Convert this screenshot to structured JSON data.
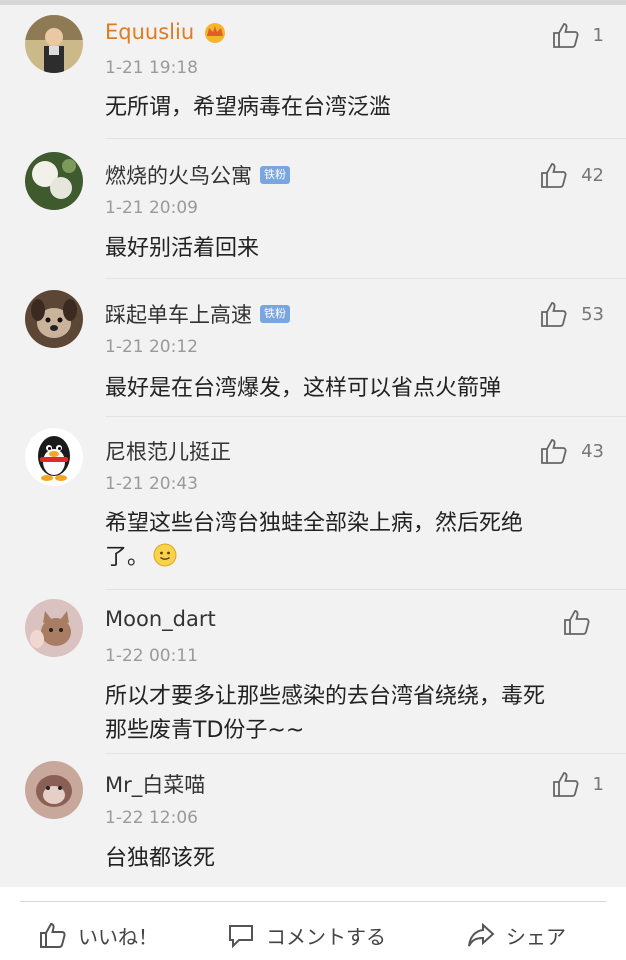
{
  "comments": [
    {
      "avatar_icon": "avatar-man-icon",
      "username": "Equusliu",
      "username_badge": "vip-crown-icon",
      "time": "1-21 19:18",
      "text": "无所谓，希望病毒在台湾泛滥",
      "likes": "1"
    },
    {
      "avatar_icon": "avatar-flower-icon",
      "username": "燃烧的火鸟公寓",
      "badge": "铁粉",
      "time": "1-21 20:09",
      "text": "最好别活着回来",
      "likes": "42"
    },
    {
      "avatar_icon": "avatar-dog-icon",
      "username": "踩起单车上高速",
      "badge": "铁粉",
      "time": "1-21 20:12",
      "text": "最好是在台湾爆发，这样可以省点火箭弹",
      "likes": "53"
    },
    {
      "avatar_icon": "avatar-qq-penguin-icon",
      "username": "尼根范儿挺正",
      "time": "1-21 20:43",
      "text_line1": "希望这些台湾台独蛙全部染上病，然后死绝",
      "text_line2": "了。",
      "text_emoji": "smile-emoji-icon",
      "likes": "43"
    },
    {
      "avatar_icon": "avatar-cat-icon",
      "username": "Moon_dart",
      "time": "1-22 00:11",
      "text_line1": "所以才要多让那些感染的去台湾省绕绕，毒死",
      "text_line2": "那些废青TD份子~~",
      "likes": ""
    },
    {
      "avatar_icon": "avatar-cat2-icon",
      "username": "Mr_白菜喵",
      "time": "1-22 12:06",
      "text": "台独都该死",
      "likes": "1"
    }
  ],
  "bottom_bar": {
    "like_label": "いいね！",
    "comment_label": "コメントする",
    "share_label": "シェア"
  },
  "colors": {
    "vip_name": "#e07b1f",
    "badge": "#7aa6e0",
    "time": "#9a9a9a"
  }
}
